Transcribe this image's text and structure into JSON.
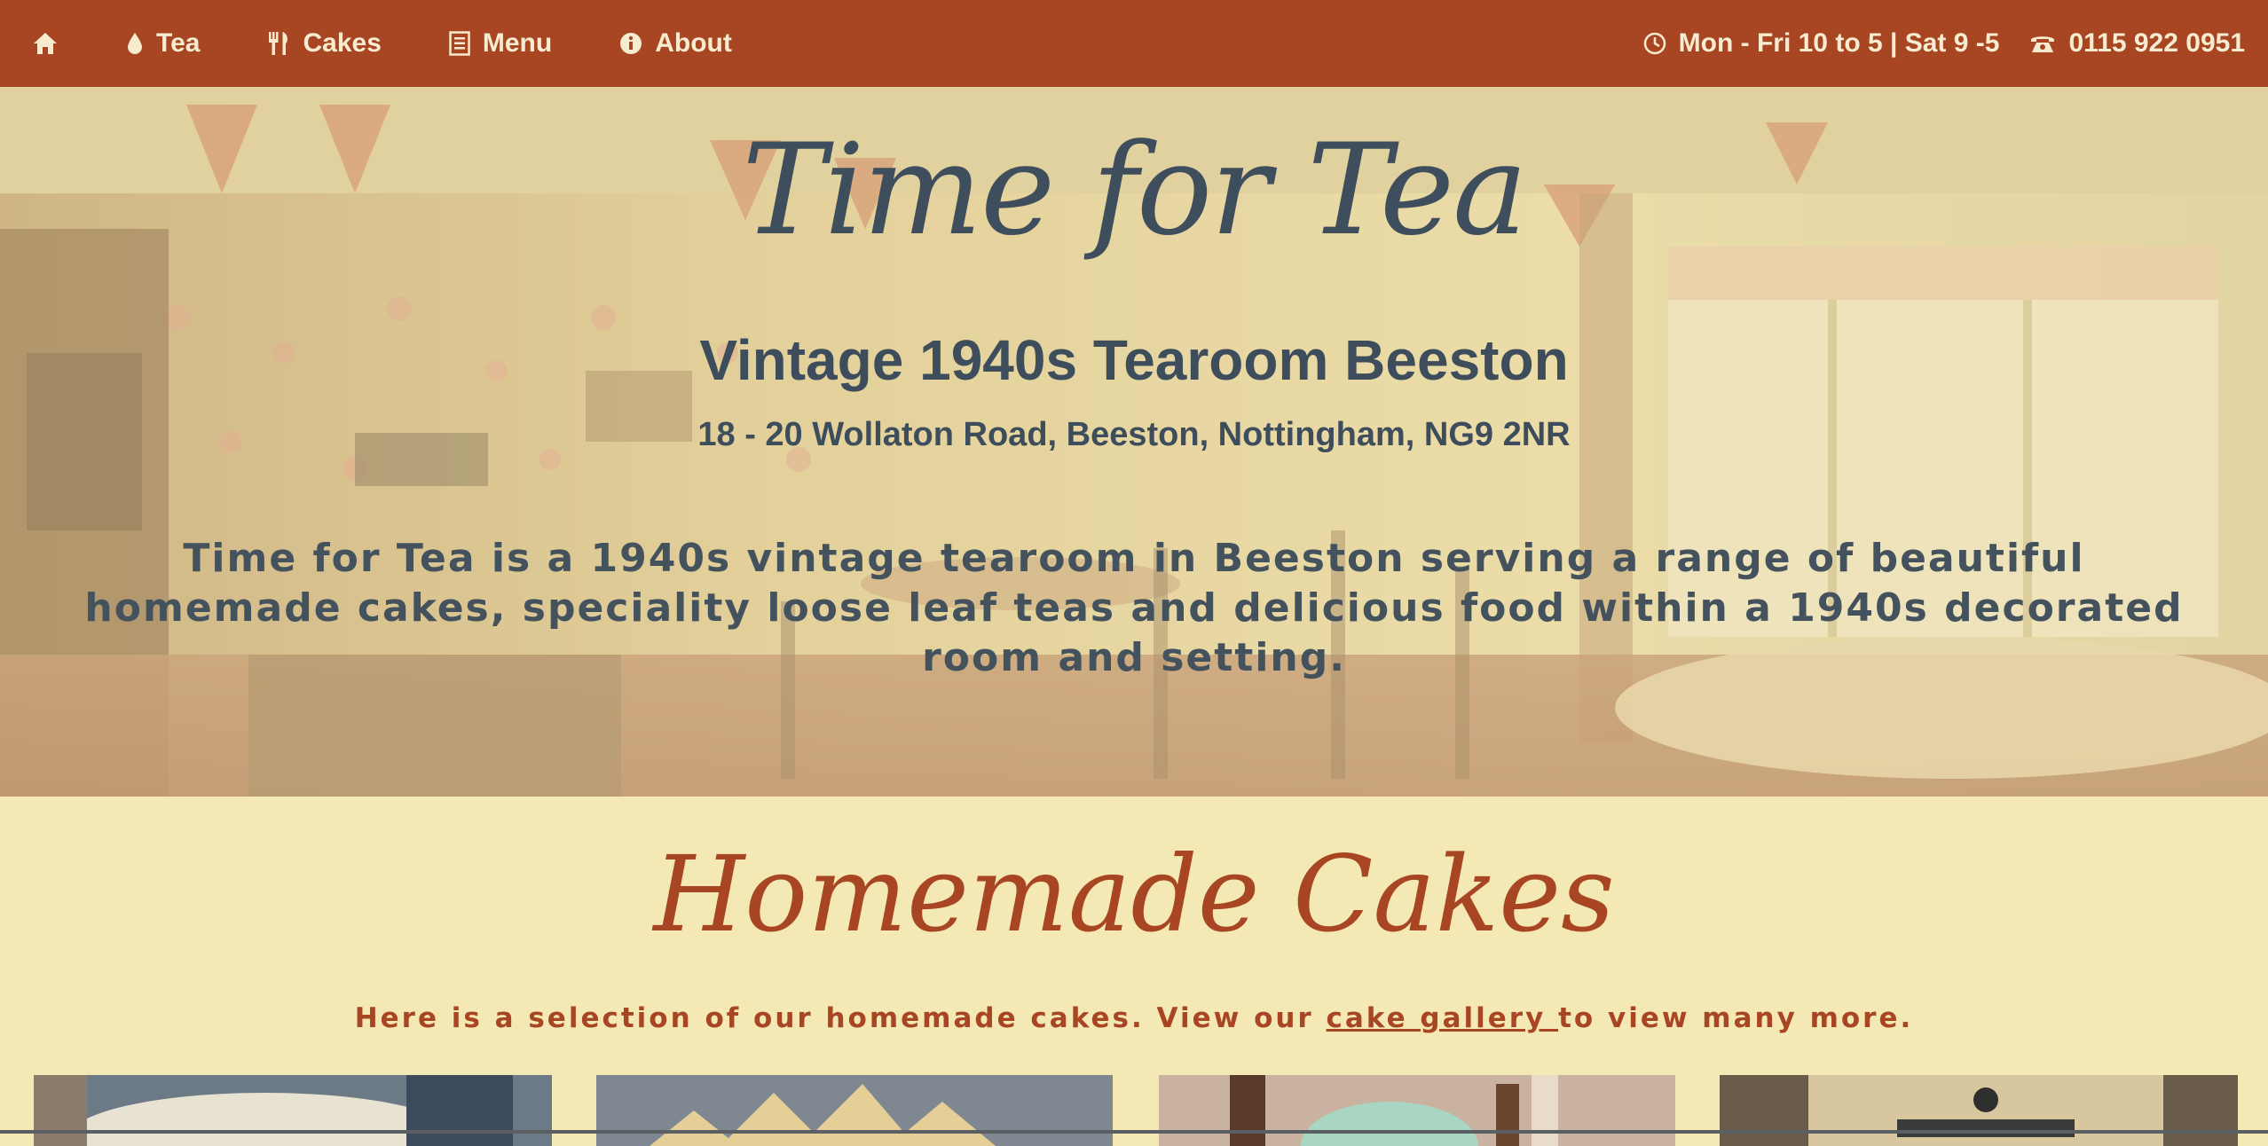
{
  "nav": {
    "items": [
      {
        "label": "Tea",
        "icon": "drop-icon"
      },
      {
        "label": "Cakes",
        "icon": "fork-knife-icon"
      },
      {
        "label": "Menu",
        "icon": "list-icon"
      },
      {
        "label": "About",
        "icon": "info-icon"
      }
    ],
    "hours": "Mon - Fri 10 to 5 | Sat 9 -5",
    "phone": "0115 922 0951"
  },
  "hero": {
    "title": "Time for Tea",
    "subtitle": "Vintage 1940s Tearoom Beeston",
    "address": "18 - 20 Wollaton Road, Beeston, Nottingham, NG9 2NR",
    "description": "Time for Tea is a 1940s vintage tearoom in Beeston serving a range of beautiful homemade cakes, speciality loose leaf teas and delicious food within a 1940s decorated room and setting."
  },
  "cakes": {
    "title": "Homemade Cakes",
    "intro_before": "Here is a selection of our homemade cakes. View our ",
    "intro_link": "cake gallery ",
    "intro_after": "to view many more."
  },
  "colors": {
    "nav_bg": "#a84623",
    "page_bg": "#f4e8b4",
    "accent": "#a84623",
    "hero_text": "#3f4e5c"
  }
}
